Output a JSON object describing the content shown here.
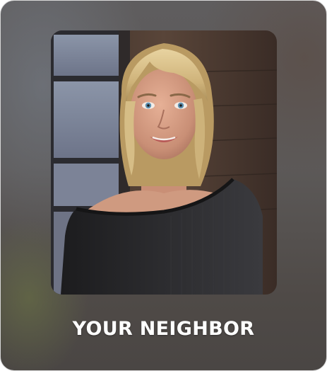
{
  "card": {
    "title": "YOUR NEIGHBOR",
    "image": "character-portrait"
  },
  "colors": {
    "card_background": "#5c5958",
    "title_text": "#ffffff",
    "hair": "#d8c08a",
    "sweater": "#2a2a2c",
    "window_frame": "#2b2b30",
    "wall_wood": "#4a3a32"
  }
}
